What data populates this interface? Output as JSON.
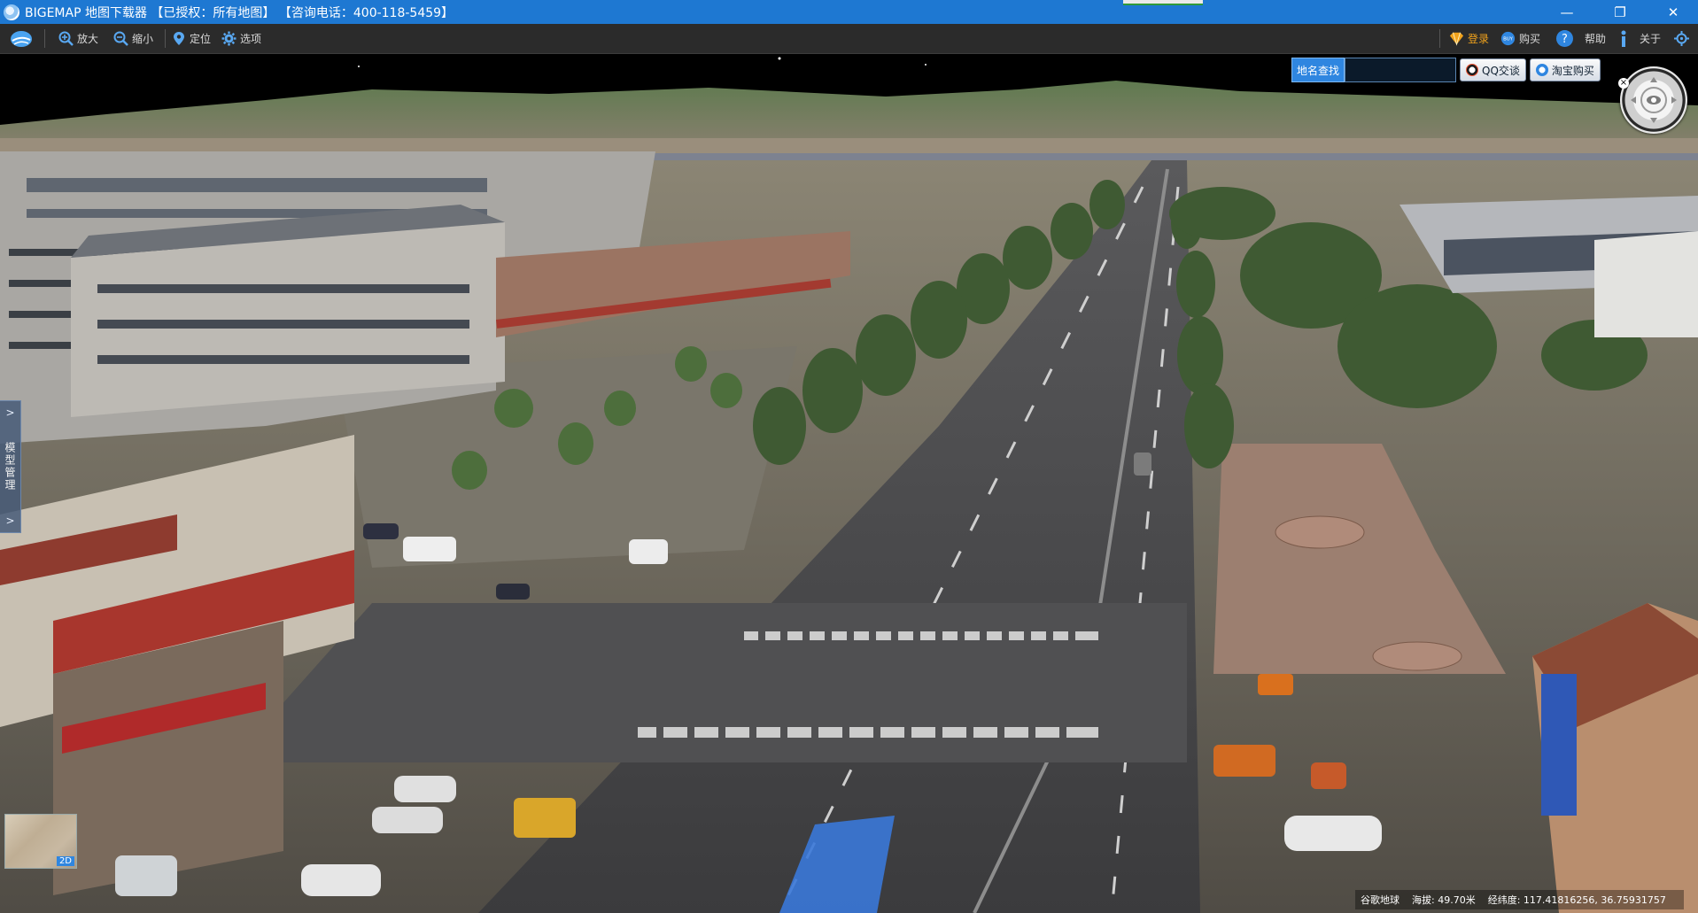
{
  "window": {
    "title": "BIGEMAP 地图下载器 【已授权：所有地图】 【咨询电话：400-118-5459】",
    "controls": [
      "—",
      "❐",
      "✕"
    ]
  },
  "toolbar": {
    "zoom_in": "放大",
    "zoom_out": "缩小",
    "locate": "定位",
    "options": "选项",
    "login": "登录",
    "buy": "购买",
    "help": "帮助",
    "about": "关于"
  },
  "search": {
    "button": "地名查找",
    "value": "",
    "qq": "QQ交谈",
    "taobao": "淘宝购买"
  },
  "side_panel": {
    "label": "模型管理"
  },
  "minimap": {
    "label": "2D"
  },
  "status": {
    "source": "谷歌地球",
    "altitude": "海拔: 49.70米",
    "coords": "经纬度:    117.41816256, 36.75931757"
  },
  "colors": {
    "titlebar": "#1e78d2",
    "toolbar": "#2b2b2b",
    "accent": "#2f86e0"
  }
}
